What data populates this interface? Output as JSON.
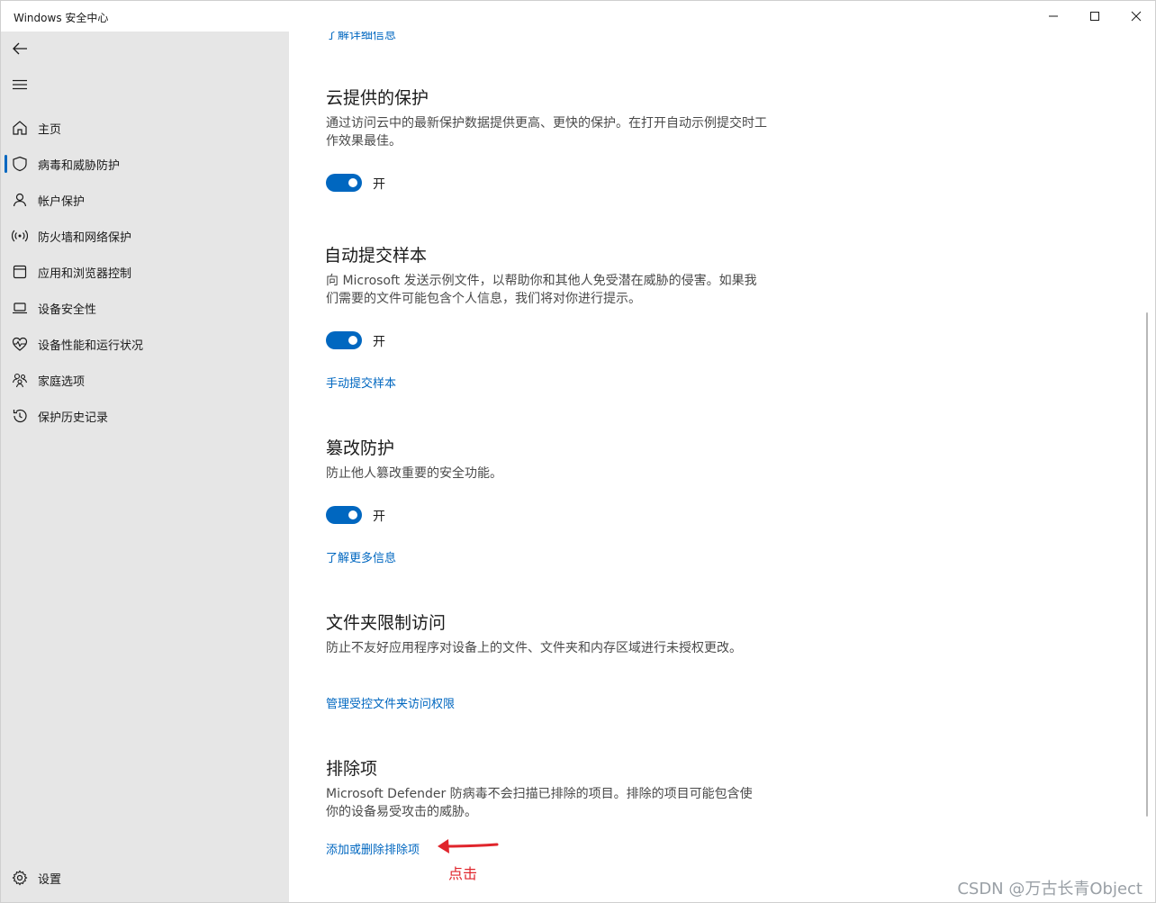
{
  "window": {
    "title": "Windows 安全中心"
  },
  "sidebar": {
    "items": [
      {
        "label": "主页",
        "icon": "home-icon"
      },
      {
        "label": "病毒和威胁防护",
        "icon": "shield-icon",
        "active": true
      },
      {
        "label": "帐户保护",
        "icon": "person-icon"
      },
      {
        "label": "防火墙和网络保护",
        "icon": "wifi-icon"
      },
      {
        "label": "应用和浏览器控制",
        "icon": "browser-icon"
      },
      {
        "label": "设备安全性",
        "icon": "laptop-icon"
      },
      {
        "label": "设备性能和运行状况",
        "icon": "heart-icon"
      },
      {
        "label": "家庭选项",
        "icon": "family-icon"
      },
      {
        "label": "保护历史记录",
        "icon": "history-icon"
      }
    ],
    "settings_label": "设置"
  },
  "main": {
    "top_link": "了解详细信息",
    "sections": {
      "cloud": {
        "title": "云提供的保护",
        "desc": "通过访问云中的最新保护数据提供更高、更快的保护。在打开自动示例提交时工作效果最佳。",
        "toggle_label": "开"
      },
      "sample": {
        "title": "自动提交样本",
        "desc": "向 Microsoft 发送示例文件，以帮助你和其他人免受潜在威胁的侵害。如果我们需要的文件可能包含个人信息，我们将对你进行提示。",
        "toggle_label": "开",
        "link": "手动提交样本"
      },
      "tamper": {
        "title": "篡改防护",
        "desc": "防止他人篡改重要的安全功能。",
        "toggle_label": "开",
        "link": "了解更多信息"
      },
      "folder": {
        "title": "文件夹限制访问",
        "desc": "防止不友好应用程序对设备上的文件、文件夹和内存区域进行未授权更改。",
        "link": "管理受控文件夹访问权限"
      },
      "exclusions": {
        "title": "排除项",
        "desc": "Microsoft Defender 防病毒不会扫描已排除的项目。排除的项目可能包含使你的设备易受攻击的威胁。",
        "link": "添加或删除排除项"
      }
    },
    "annotation": "点击"
  },
  "watermark": "CSDN @万古长青Object",
  "colors": {
    "accent": "#0067c0",
    "sidebar_bg": "#e6e6e6",
    "annotation": "#e0252c"
  }
}
